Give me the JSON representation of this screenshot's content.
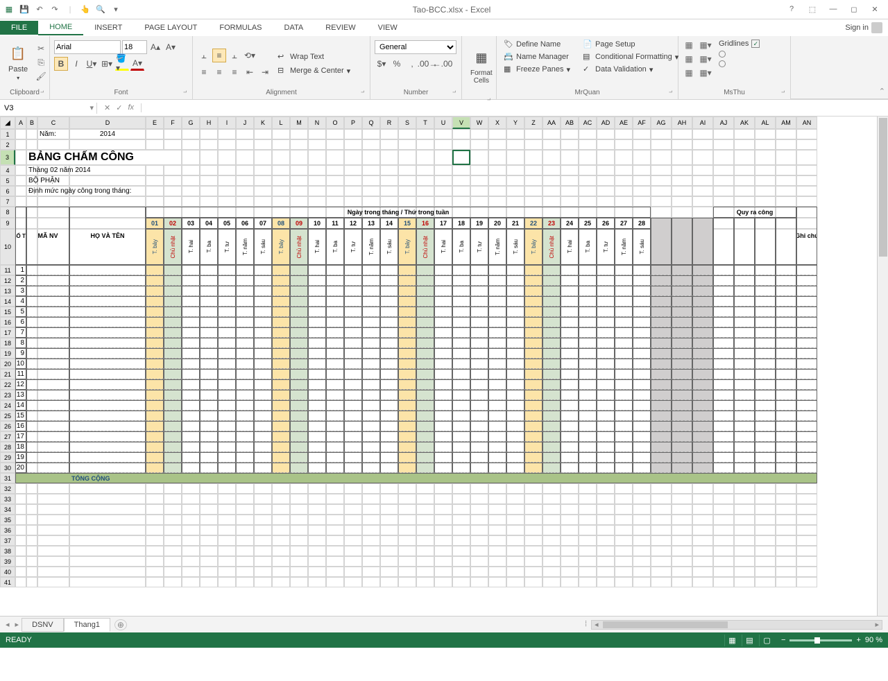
{
  "app": {
    "title": "Tao-BCC.xlsx - Excel",
    "signin": "Sign in"
  },
  "tabs": {
    "file": "FILE",
    "home": "HOME",
    "insert": "INSERT",
    "pagelayout": "PAGE LAYOUT",
    "formulas": "FORMULAS",
    "data": "DATA",
    "review": "REVIEW",
    "view": "VIEW"
  },
  "ribbon": {
    "clipboard": {
      "paste": "Paste",
      "label": "Clipboard"
    },
    "font": {
      "name": "Arial",
      "size": "18",
      "label": "Font"
    },
    "alignment": {
      "wrap": "Wrap Text",
      "merge": "Merge & Center",
      "label": "Alignment"
    },
    "number": {
      "format": "General",
      "label": "Number"
    },
    "formatcells": "Format Cells",
    "mrquan": {
      "defname": "Define Name",
      "namemgr": "Name Manager",
      "freeze": "Freeze Panes",
      "pagesetup": "Page Setup",
      "condfmt": "Conditional Formatting",
      "dataval": "Data Validation",
      "label": "MrQuan"
    },
    "msthu": {
      "gridlines": "Gridlines",
      "label": "MsThu"
    }
  },
  "formula": {
    "namebox": "V3"
  },
  "colHeaders": [
    "A",
    "B",
    "C",
    "D",
    "E",
    "F",
    "G",
    "H",
    "I",
    "J",
    "K",
    "L",
    "M",
    "N",
    "O",
    "P",
    "Q",
    "R",
    "S",
    "T",
    "U",
    "V",
    "W",
    "X",
    "Y",
    "Z",
    "AA",
    "AB",
    "AC",
    "AD",
    "AE",
    "AF",
    "AG",
    "AH",
    "AI",
    "AJ",
    "AK",
    "AL",
    "AM",
    "AN"
  ],
  "rowHeaders": [
    1,
    2,
    3,
    4,
    5,
    6,
    7,
    8,
    9,
    10,
    11,
    12,
    13,
    14,
    15,
    16,
    17,
    18,
    19,
    20,
    21,
    22,
    23,
    24,
    25,
    26,
    27,
    28,
    29,
    30,
    31,
    32,
    33,
    34,
    35,
    36,
    37,
    38,
    39,
    40,
    41
  ],
  "content": {
    "nam_label": "Năm:",
    "nam_value": "2014",
    "title": "BẢNG CHẤM CÔNG",
    "subtitle": "Tháng 02 năm 2014",
    "bo_phan": "BỘ PHẬN",
    "dinh_muc": "Định mức ngày công trong tháng:",
    "so_tt": "SỐ TT",
    "ma_nv": "MÃ NV",
    "ho_ten": "HỌ VÀ TÊN",
    "ngay_header": "Ngày trong tháng / Thứ trong tuần",
    "quy_ra_cong": "Quy ra công",
    "ghi_chu": "Ghi chú",
    "tong_cong": "TỔNG CỘNG",
    "days": [
      {
        "d": "01",
        "w": "T. bảy",
        "c": "blue",
        "bg": "orange"
      },
      {
        "d": "02",
        "w": "Chủ nhật",
        "c": "red",
        "bg": "green"
      },
      {
        "d": "03",
        "w": "T. hai"
      },
      {
        "d": "04",
        "w": "T. ba"
      },
      {
        "d": "05",
        "w": "T. tư"
      },
      {
        "d": "06",
        "w": "T. năm"
      },
      {
        "d": "07",
        "w": "T. sáu"
      },
      {
        "d": "08",
        "w": "T. bảy",
        "c": "blue",
        "bg": "orange"
      },
      {
        "d": "09",
        "w": "Chủ nhật",
        "c": "red",
        "bg": "green"
      },
      {
        "d": "10",
        "w": "T. hai"
      },
      {
        "d": "11",
        "w": "T. ba"
      },
      {
        "d": "12",
        "w": "T. tư"
      },
      {
        "d": "13",
        "w": "T. năm"
      },
      {
        "d": "14",
        "w": "T. sáu"
      },
      {
        "d": "15",
        "w": "T. bảy",
        "c": "blue",
        "bg": "orange"
      },
      {
        "d": "16",
        "w": "Chủ nhật",
        "c": "red",
        "bg": "green"
      },
      {
        "d": "17",
        "w": "T. hai"
      },
      {
        "d": "18",
        "w": "T. ba"
      },
      {
        "d": "19",
        "w": "T. tư"
      },
      {
        "d": "20",
        "w": "T. năm"
      },
      {
        "d": "21",
        "w": "T. sáu"
      },
      {
        "d": "22",
        "w": "T. bảy",
        "c": "blue",
        "bg": "orange"
      },
      {
        "d": "23",
        "w": "Chủ nhật",
        "c": "red",
        "bg": "green"
      },
      {
        "d": "24",
        "w": "T. hai"
      },
      {
        "d": "25",
        "w": "T. ba"
      },
      {
        "d": "26",
        "w": "T. tư"
      },
      {
        "d": "27",
        "w": "T. năm"
      },
      {
        "d": "28",
        "w": "T. sáu"
      }
    ],
    "rownums": [
      1,
      2,
      3,
      4,
      5,
      6,
      7,
      8,
      9,
      10,
      11,
      12,
      13,
      14,
      15,
      16,
      17,
      18,
      19,
      20
    ]
  },
  "sheets": {
    "dsnv": "DSNV",
    "thang1": "Thang1"
  },
  "status": {
    "ready": "READY",
    "zoom": "90 %"
  }
}
